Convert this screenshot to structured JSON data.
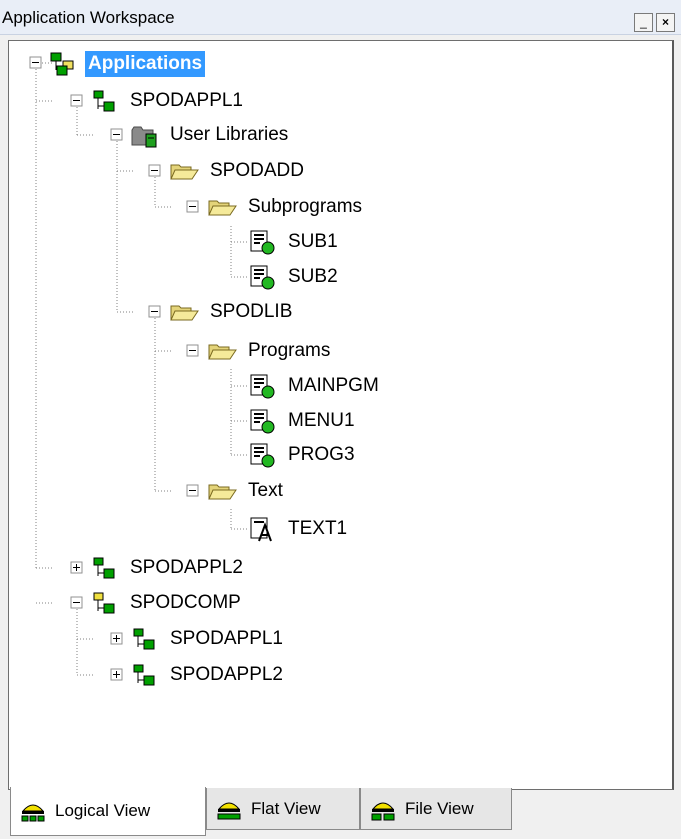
{
  "window": {
    "title": "Application Workspace",
    "minimize_glyph": "_",
    "close_glyph": "×"
  },
  "tree": {
    "root": {
      "label": "Applications",
      "icon": "application-group-icon"
    },
    "spodappl1": {
      "label": "SPODAPPL1",
      "icon": "application-icon"
    },
    "user_libraries": {
      "label": "User Libraries",
      "icon": "library-folder-icon"
    },
    "spodadd": {
      "label": "SPODADD",
      "icon": "open-folder-icon"
    },
    "subprograms": {
      "label": "Subprograms",
      "icon": "open-folder-icon"
    },
    "sub1": {
      "label": "SUB1",
      "icon": "program-object-icon"
    },
    "sub2": {
      "label": "SUB2",
      "icon": "program-object-icon"
    },
    "spodlib": {
      "label": "SPODLIB",
      "icon": "open-folder-icon"
    },
    "programs": {
      "label": "Programs",
      "icon": "open-folder-icon"
    },
    "mainpgm": {
      "label": "MAINPGM",
      "icon": "program-object-icon"
    },
    "menu1": {
      "label": "MENU1",
      "icon": "program-object-icon"
    },
    "prog3": {
      "label": "PROG3",
      "icon": "program-object-icon"
    },
    "text": {
      "label": "Text",
      "icon": "open-folder-icon"
    },
    "text1": {
      "label": "TEXT1",
      "icon": "text-object-icon"
    },
    "spodappl2": {
      "label": "SPODAPPL2",
      "icon": "application-icon"
    },
    "spodcomp": {
      "label": "SPODCOMP",
      "icon": "compound-application-icon"
    },
    "spodcomp_appl1": {
      "label": "SPODAPPL1",
      "icon": "application-icon"
    },
    "spodcomp_appl2": {
      "label": "SPODAPPL2",
      "icon": "application-icon"
    }
  },
  "tabs": {
    "logical": {
      "label": "Logical View",
      "active": true
    },
    "flat": {
      "label": "Flat View",
      "active": false
    },
    "file": {
      "label": "File View",
      "active": false
    }
  },
  "colors": {
    "selection": "#3399ff",
    "app_green": "#00a000",
    "folder_yellow": "#f1e38a",
    "tree_lines": "#808080"
  }
}
